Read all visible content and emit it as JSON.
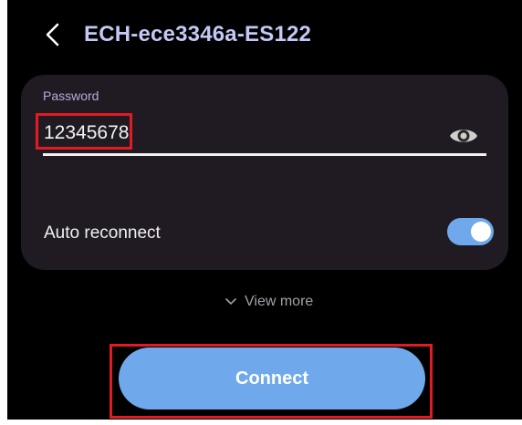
{
  "header": {
    "title": "ECH-ece3346a-ES122",
    "back_icon": "chevron-left-icon"
  },
  "password": {
    "label": "Password",
    "value": "12345678",
    "visibility_icon": "eye-icon"
  },
  "auto_reconnect": {
    "label": "Auto reconnect",
    "enabled": true
  },
  "view_more": {
    "label": "View more",
    "icon": "chevron-down-icon"
  },
  "connect": {
    "label": "Connect"
  },
  "colors": {
    "background": "#000000",
    "card": "#201b22",
    "title": "#c3c8f5",
    "accent": "#6fa9ec",
    "highlight": "#e21b23"
  }
}
